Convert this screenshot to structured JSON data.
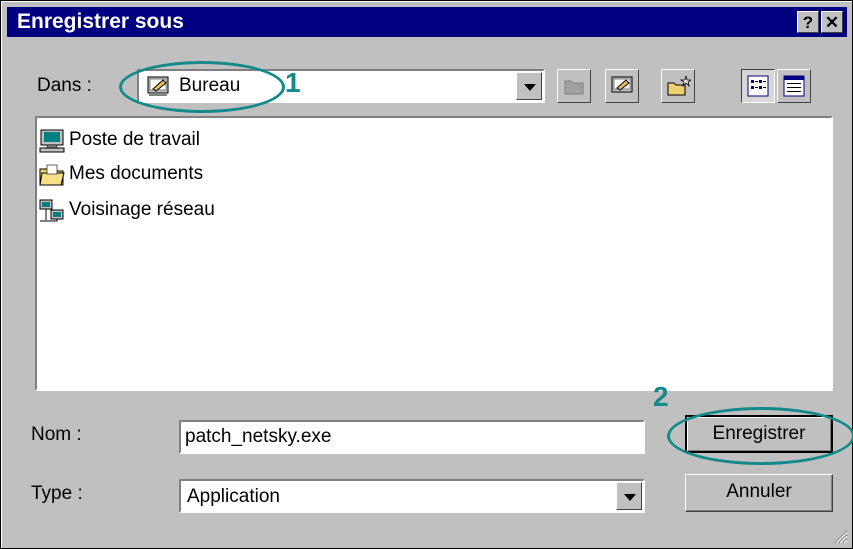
{
  "window": {
    "title": "Enregistrer sous",
    "help_label": "?",
    "close_label": "✕"
  },
  "location": {
    "label": "Dans :",
    "value": "Bureau"
  },
  "toolbar": {
    "icons": [
      "up-folder-icon",
      "desktop-icon",
      "new-folder-icon",
      "list-view-icon",
      "details-view-icon"
    ]
  },
  "files": [
    {
      "name": "Poste de travail",
      "icon": "computer-icon"
    },
    {
      "name": "Mes documents",
      "icon": "folder-icon"
    },
    {
      "name": "Voisinage réseau",
      "icon": "network-icon"
    }
  ],
  "filename": {
    "label": "Nom :",
    "value": "patch_netsky.exe"
  },
  "filetype": {
    "label": "Type :",
    "value": "Application"
  },
  "buttons": {
    "save": "Enregistrer",
    "cancel": "Annuler"
  },
  "annotations": {
    "step1": "1",
    "step2": "2",
    "color": "#128a8a"
  }
}
